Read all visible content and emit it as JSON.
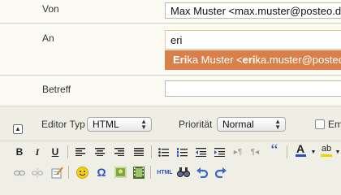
{
  "form": {
    "from_label": "Von",
    "from_value": "Max Muster <max.muster@posteo.de>",
    "to_label": "An",
    "to_value": "eri",
    "suggestion_match": "Eri",
    "suggestion_rest_name": "ka Muster <",
    "suggestion_match2": "eri",
    "suggestion_rest_addr": "ka.muster@posteo.de",
    "subject_label": "Betreff",
    "subject_value": ""
  },
  "options": {
    "editor_type_label": "Editor Typ",
    "editor_type_value": "HTML",
    "priority_label": "Priorität",
    "priority_value": "Normal",
    "trailing_label": "Em"
  },
  "colors": {
    "suggestion_bg": "#d9804a",
    "focus_border": "#f1c48c",
    "font_color_swatch": "#2a4fc2",
    "highlight_swatch": "#f0d000"
  },
  "toolbar_row1": [
    "bold-icon",
    "italic-icon",
    "underline-icon",
    "align-left-icon",
    "align-center-icon",
    "align-right-icon",
    "align-justify-icon",
    "bulleted-list-icon",
    "numbered-list-icon",
    "outdent-icon",
    "indent-icon",
    "ltr-icon",
    "rtl-icon",
    "blockquote-icon",
    "font-color-icon",
    "highlight-color-icon"
  ],
  "toolbar_row2": [
    "link-icon",
    "unlink-icon",
    "edit-source-icon",
    "emoticon-icon",
    "special-character-icon",
    "image-icon",
    "media-icon",
    "html-source-icon",
    "find-replace-icon",
    "undo-icon",
    "redo-icon"
  ],
  "toolbar_text": {
    "bold": "B",
    "italic": "I",
    "underline": "U",
    "blockquote": "“",
    "font_color": "A",
    "highlight": "ab",
    "special_char": "Ω",
    "html": "HTML"
  }
}
